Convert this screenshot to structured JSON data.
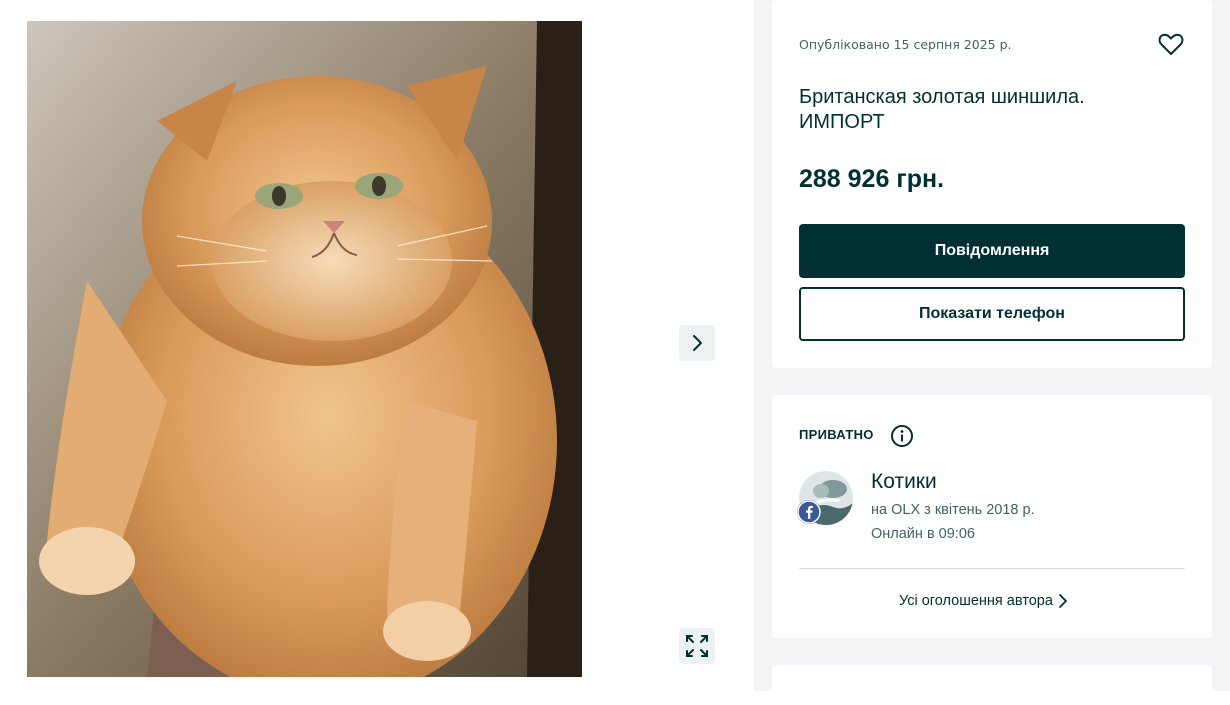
{
  "gallery": {
    "photo_alt": "cat-photo",
    "next_icon": "chevron-right-icon",
    "fullscreen_icon": "expand-icon"
  },
  "ad": {
    "published": "Опубліковано 15 серпня 2025 р.",
    "title": "Британская золотая шиншила. ИМПОРТ",
    "price": "288 926 грн.",
    "message_button": "Повідомлення",
    "phone_button": "Показати телефон",
    "favorite_icon": "heart-icon"
  },
  "seller": {
    "type_label": "ПРИВАТНО",
    "info_icon": "info-icon",
    "name": "Котики",
    "since": "на OLX з квітень 2018 р.",
    "online": "Онлайн в 09:06",
    "all_ads_link": "Усі оголошення автора",
    "social_badge": "facebook-icon"
  },
  "colors": {
    "primary": "#002f34",
    "secondary_text": "#406367",
    "page_bg": "#f2f4f5"
  }
}
